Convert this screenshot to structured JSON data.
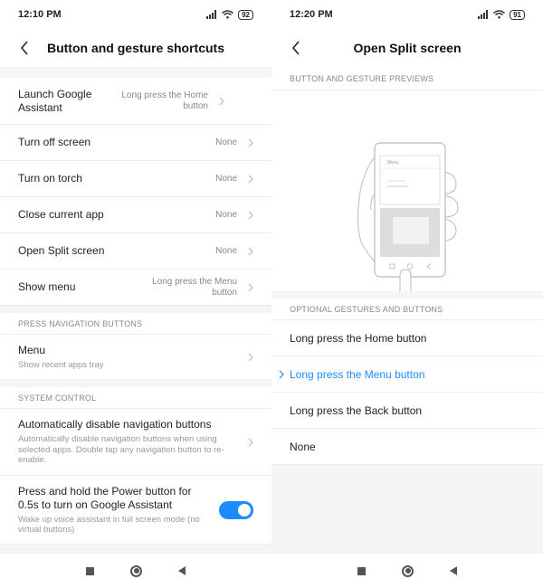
{
  "left": {
    "status": {
      "time": "12:10 PM",
      "battery": "92"
    },
    "title": "Button and gesture shortcuts",
    "shortcuts": [
      {
        "label": "Launch Google Assistant",
        "value": "Long press the Home button"
      },
      {
        "label": "Turn off screen",
        "value": "None"
      },
      {
        "label": "Turn on torch",
        "value": "None"
      },
      {
        "label": "Close current app",
        "value": "None"
      },
      {
        "label": "Open Split screen",
        "value": "None"
      },
      {
        "label": "Show menu",
        "value": "Long press the Menu button"
      }
    ],
    "nav_section": {
      "header": "PRESS NAVIGATION BUTTONS",
      "menu": {
        "label": "Menu",
        "sub": "Show recent apps tray"
      }
    },
    "system_section": {
      "header": "SYSTEM CONTROL",
      "auto_disable": {
        "label": "Automatically disable navigation buttons",
        "sub": "Automatically disable navigation buttons when using selected apps. Double tap any navigation button to re-enable."
      },
      "power_hold": {
        "label": "Press and hold the Power button for 0.5s to turn on Google Assistant",
        "sub": "Wake up voice assistant in full screen mode (no virtual buttons)",
        "enabled": true
      }
    }
  },
  "right": {
    "status": {
      "time": "12:20 PM",
      "battery": "91"
    },
    "title": "Open Split screen",
    "previews_header": "BUTTON AND GESTURE PREVIEWS",
    "preview_menu_label": "Menu",
    "options_header": "OPTIONAL GESTURES AND BUTTONS",
    "options": [
      {
        "label": "Long press the Home button",
        "selected": false
      },
      {
        "label": "Long press the Menu button",
        "selected": true
      },
      {
        "label": "Long press the Back button",
        "selected": false
      },
      {
        "label": "None",
        "selected": false
      }
    ]
  },
  "colors": {
    "accent": "#1a8cff",
    "section_bg": "#f5f5f5",
    "divider": "#ececec"
  }
}
